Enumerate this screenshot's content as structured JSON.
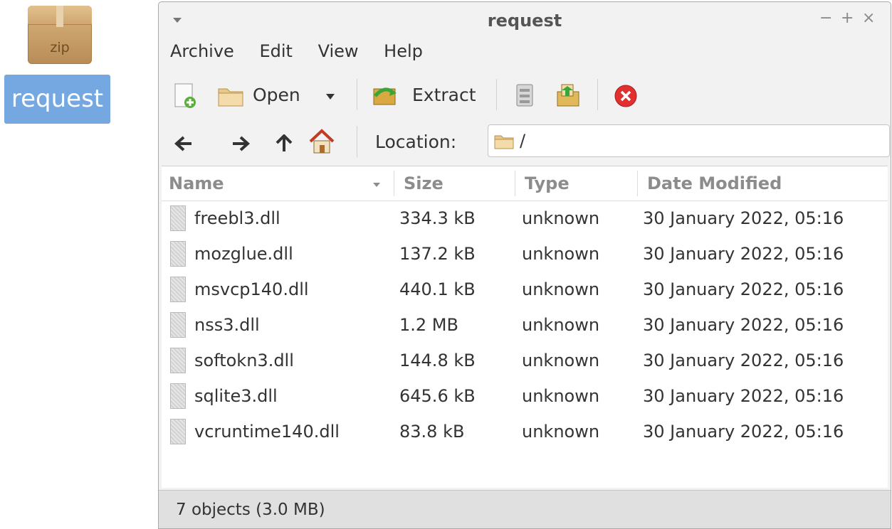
{
  "desktop": {
    "icon_badge": "zip",
    "icon_label": "request"
  },
  "window": {
    "title": "request",
    "controls": {
      "minimize": "−",
      "maximize": "+",
      "close": "×"
    }
  },
  "menu": [
    "Archive",
    "Edit",
    "View",
    "Help"
  ],
  "toolbar": {
    "open_label": "Open",
    "extract_label": "Extract"
  },
  "location": {
    "label": "Location:",
    "value": "/"
  },
  "columns": [
    "Name",
    "Size",
    "Type",
    "Date Modified"
  ],
  "files": [
    {
      "name": "freebl3.dll",
      "size": "334.3 kB",
      "type": "unknown",
      "date": "30 January 2022, 05:16"
    },
    {
      "name": "mozglue.dll",
      "size": "137.2 kB",
      "type": "unknown",
      "date": "30 January 2022, 05:16"
    },
    {
      "name": "msvcp140.dll",
      "size": "440.1 kB",
      "type": "unknown",
      "date": "30 January 2022, 05:16"
    },
    {
      "name": "nss3.dll",
      "size": "1.2 MB",
      "type": "unknown",
      "date": "30 January 2022, 05:16"
    },
    {
      "name": "softokn3.dll",
      "size": "144.8 kB",
      "type": "unknown",
      "date": "30 January 2022, 05:16"
    },
    {
      "name": "sqlite3.dll",
      "size": "645.6 kB",
      "type": "unknown",
      "date": "30 January 2022, 05:16"
    },
    {
      "name": "vcruntime140.dll",
      "size": "83.8 kB",
      "type": "unknown",
      "date": "30 January 2022, 05:16"
    }
  ],
  "status": "7 objects (3.0 MB)"
}
